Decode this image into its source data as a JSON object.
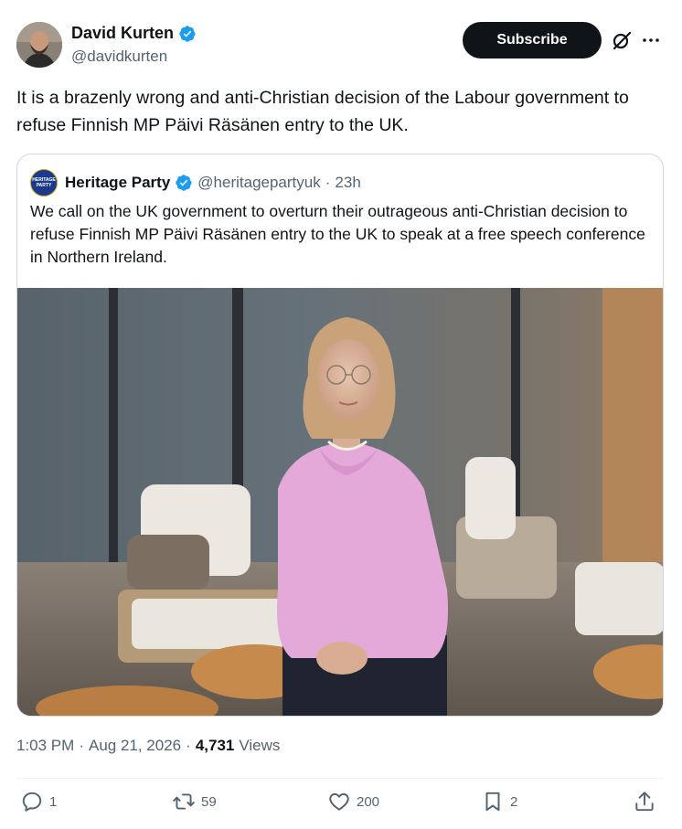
{
  "author": {
    "display_name": "David Kurten",
    "handle": "@davidkurten"
  },
  "header": {
    "subscribe_label": "Subscribe"
  },
  "tweet": {
    "text": "It is a brazenly wrong and anti-Christian decision of the Labour government to refuse Finnish MP Päivi Räsänen entry to the UK."
  },
  "quoted": {
    "display_name": "Heritage Party",
    "handle": "@heritagepartyuk",
    "separator": "·",
    "time": "23h",
    "avatar_text": "HERITAGE PARTY",
    "text": "We call on the UK government to overturn their outrageous anti-Christian decision to refuse Finnish MP Päivi Räsänen entry to the UK to speak at a free speech conference in Northern Ireland."
  },
  "meta": {
    "time": "1:03 PM",
    "dot1": "·",
    "date": "Aug 21, 2026",
    "dot2": "·",
    "views_count": "4,731",
    "views_label": "Views"
  },
  "actions": {
    "replies": "1",
    "reposts": "59",
    "likes": "200",
    "bookmarks": "2"
  },
  "colors": {
    "verified": "#1d9bf0",
    "text_primary": "#0f1419",
    "text_secondary": "#536471",
    "border": "#cfd9de",
    "sweater": "#e4a9d9"
  },
  "icons": [
    "verified-badge-icon",
    "grok-icon",
    "more-icon",
    "reply-icon",
    "repost-icon",
    "like-icon",
    "bookmark-icon",
    "share-icon"
  ]
}
